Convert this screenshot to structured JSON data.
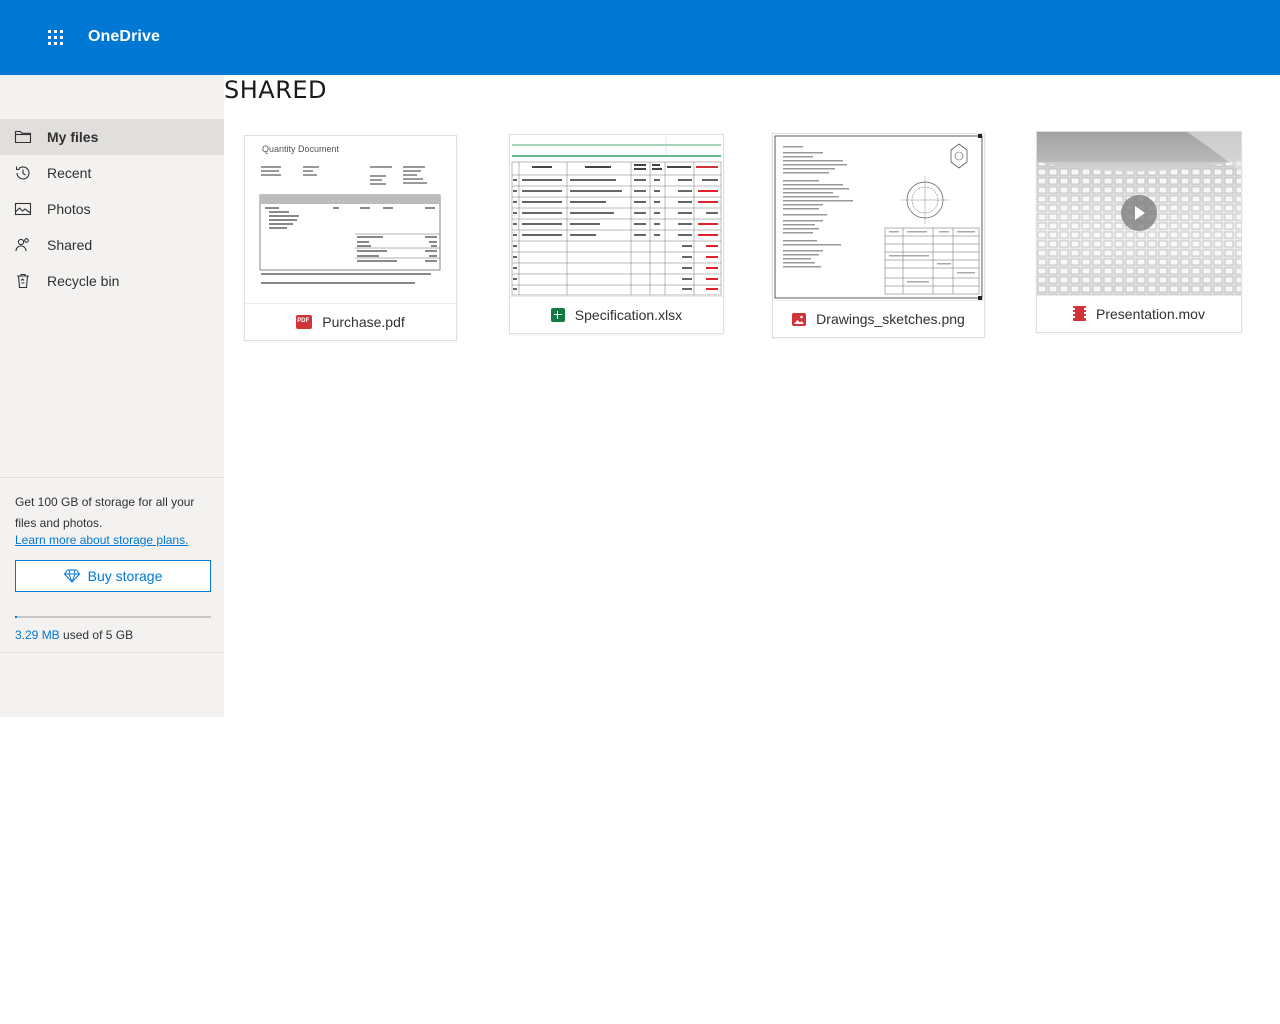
{
  "app": {
    "title": "OneDrive"
  },
  "nav": {
    "items": [
      {
        "label": "My files",
        "icon": "folder-icon",
        "active": true
      },
      {
        "label": "Recent",
        "icon": "clock-icon",
        "active": false
      },
      {
        "label": "Photos",
        "icon": "photo-icon",
        "active": false
      },
      {
        "label": "Shared",
        "icon": "people-icon",
        "active": false
      },
      {
        "label": "Recycle bin",
        "icon": "recycle-bin-icon",
        "active": false
      }
    ]
  },
  "storage": {
    "promo_text": "Get 100 GB of storage for all your files and photos.",
    "learn_more": "Learn more about storage plans.",
    "buy_label": "Buy storage",
    "used": "3.29 MB",
    "used_suffix": " used of 5 GB",
    "used_fraction": 0.0007
  },
  "page": {
    "title": "SHARED"
  },
  "files": [
    {
      "name": "Purchase.pdf",
      "type": "pdf",
      "icon": "pdf-icon",
      "color": "#d13438",
      "thumb_title": "Quantity Document"
    },
    {
      "name": "Specification.xlsx",
      "type": "xlsx",
      "icon": "excel-icon",
      "color": "#107c41"
    },
    {
      "name": "Drawings_sketches.png",
      "type": "png",
      "icon": "image-icon",
      "color": "#d13438"
    },
    {
      "name": "Presentation.mov",
      "type": "mov",
      "icon": "video-icon",
      "color": "#d13438"
    }
  ],
  "colors": {
    "brand": "#0078d4",
    "sidebar": "#f3f2f1",
    "active": "#e1dfdd"
  }
}
